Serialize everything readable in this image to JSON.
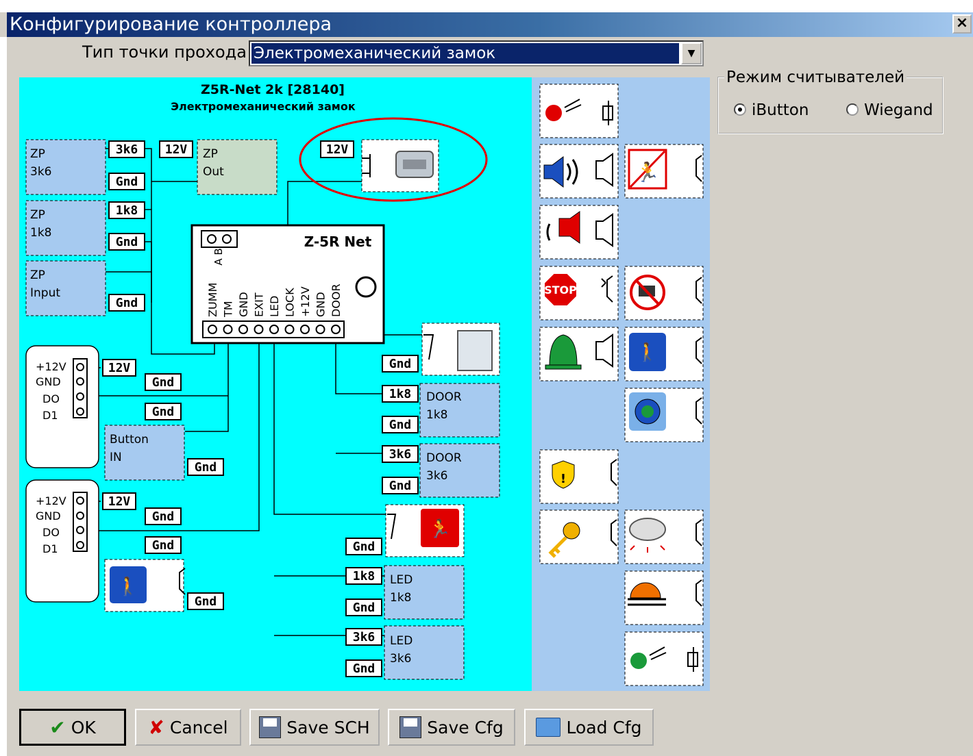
{
  "window": {
    "title": "Конфигурирование контроллера",
    "close_label": "×"
  },
  "access_point": {
    "label": "Тип точки прохода",
    "value": "Электромеханический замок"
  },
  "reader_mode": {
    "legend": "Режим считывателей",
    "options": [
      "iButton",
      "Wiegand"
    ],
    "selected": "iButton"
  },
  "diagram": {
    "title": "Z5R-Net 2k [28140]",
    "subtitle": "Электромеханический замок",
    "controller_label": "Z-5R Net",
    "ab_label": "A B",
    "pins": [
      "ZUMM",
      "TM",
      "GND",
      "EXIT",
      "LED",
      "LOCK",
      "+12V",
      "GND",
      "DOOR"
    ],
    "zones": [
      {
        "l1": "ZP",
        "l2": "3k6"
      },
      {
        "l1": "ZP",
        "l2": "1k8"
      },
      {
        "l1": "ZP",
        "l2": "Input"
      },
      {
        "l1": "ZP",
        "l2": "Out"
      },
      {
        "l1": "Button",
        "l2": "IN"
      },
      {
        "l1": "DOOR",
        "l2": "1k8"
      },
      {
        "l1": "DOOR",
        "l2": "3k6"
      },
      {
        "l1": "LED",
        "l2": "1k8"
      },
      {
        "l1": "LED",
        "l2": "3k6"
      }
    ],
    "tags": {
      "r3k6": "3k6",
      "r1k8": "1k8",
      "v12": "12V",
      "gnd": "Gnd"
    },
    "reader_pins": [
      "+12V",
      "GND",
      "DO",
      "D1"
    ],
    "stop_text": "STOP",
    "palette_icons": [
      "red-led-icon",
      "speaker-icon",
      "no-exit-icon",
      "siren-icon",
      "stop-sign-icon",
      "no-camera-icon",
      "bell-icon",
      "exit-person-icon",
      "alarm-button-icon",
      "warning-shield-icon",
      "key-icon",
      "smoke-detector-icon",
      "sunset-icon",
      "green-led-icon"
    ]
  },
  "buttons": {
    "ok": "OK",
    "cancel": "Cancel",
    "save_sch": "Save SCH",
    "save_cfg": "Save Cfg",
    "load_cfg": "Load Cfg"
  },
  "colors": {
    "canvas": "#00ffff",
    "palette": "#a6caf0",
    "zone": "#a6caf0",
    "highlight_ellipse": "#e00000"
  }
}
